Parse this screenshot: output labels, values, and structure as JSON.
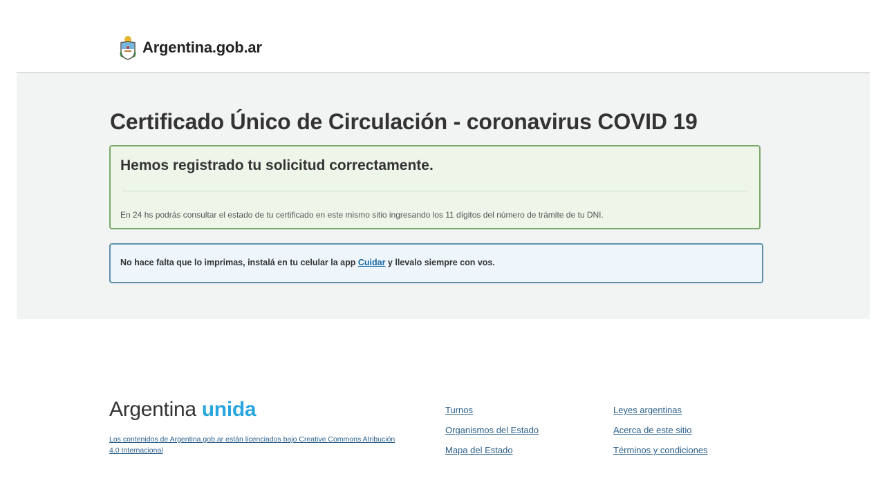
{
  "header": {
    "brand": "Argentina.gob.ar"
  },
  "main": {
    "title": "Certificado Único de Circulación - coronavirus COVID 19",
    "success_alert": {
      "heading": "Hemos registrado tu solicitud correctamente.",
      "body": "En 24 hs podrás consultar el estado de tu certificado en este mismo sitio ingresando los 11 dígitos del número de trámite de tu DNI."
    },
    "info_alert": {
      "text_before": "No hace falta que lo imprimas, instalá en tu celular la app ",
      "link": "Cuidar",
      "text_after": " y llevalo siempre con vos."
    }
  },
  "footer": {
    "logo_word1": "Argentina",
    "logo_word2": "unida",
    "license_text": "Los contenidos de Argentina.gob.ar están licenciados bajo Creative Commons Atribución 4.0 Internacional",
    "links_col1": [
      "Turnos",
      "Organismos del Estado",
      "Mapa del Estado"
    ],
    "links_col2": [
      "Leyes argentinas",
      "Acerca de este sitio",
      "Términos y condiciones"
    ]
  },
  "icons": {
    "brand_icon": "argentina-coat-of-arms-icon"
  },
  "colors": {
    "success_border": "#7ca86a",
    "success_bg": "#eef6ea",
    "info_border": "#5e8fa8",
    "info_bg": "#eef6fb",
    "link": "#2a5f8a",
    "logo_accent": "#2aa6de",
    "band_bg": "#f2f3f3"
  }
}
